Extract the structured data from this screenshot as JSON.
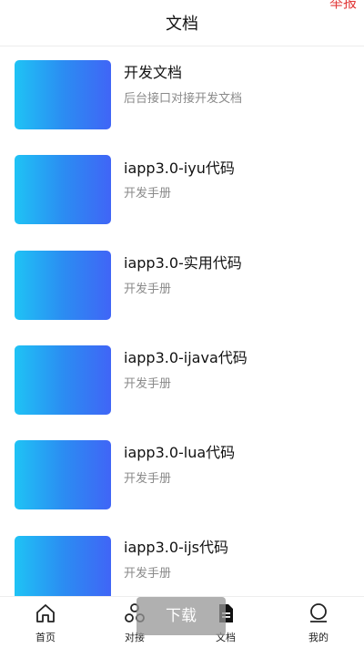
{
  "header": {
    "title": "文档",
    "report_label": "举报"
  },
  "docs": [
    {
      "title": "开发文档",
      "subtitle": "后台接口对接开发文档"
    },
    {
      "title": "iapp3.0-iyu代码",
      "subtitle": "开发手册"
    },
    {
      "title": "iapp3.0-实用代码",
      "subtitle": "开发手册"
    },
    {
      "title": "iapp3.0-ijava代码",
      "subtitle": "开发手册"
    },
    {
      "title": "iapp3.0-lua代码",
      "subtitle": "开发手册"
    },
    {
      "title": "iapp3.0-ijs代码",
      "subtitle": "开发手册"
    }
  ],
  "tabbar": {
    "items": [
      {
        "label": "首页",
        "icon": "home-icon"
      },
      {
        "label": "对接",
        "icon": "connect-icon"
      },
      {
        "label": "文档",
        "icon": "document-icon",
        "active": true
      },
      {
        "label": "我的",
        "icon": "profile-icon"
      }
    ]
  },
  "toast": {
    "text": "下载"
  },
  "colors": {
    "thumb_gradient_start": "#1fc3f5",
    "thumb_gradient_end": "#4065f6",
    "report_red": "#e23b3b"
  }
}
